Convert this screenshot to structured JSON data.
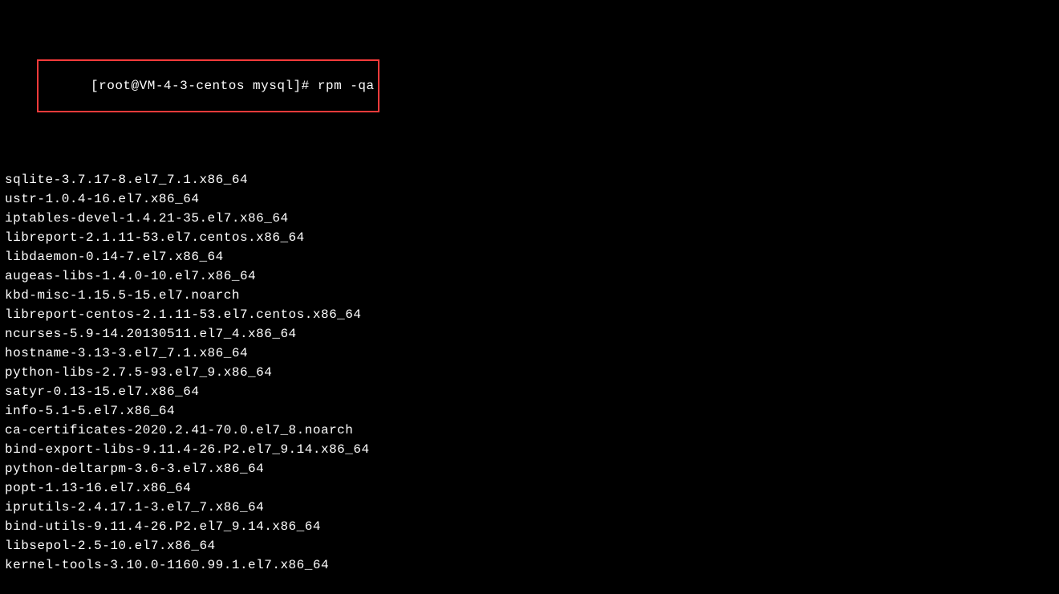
{
  "terminal": {
    "prompt": "[root@VM-4-3-centos mysql]# ",
    "command": "rpm -qa",
    "output": [
      "sqlite-3.7.17-8.el7_7.1.x86_64",
      "ustr-1.0.4-16.el7.x86_64",
      "iptables-devel-1.4.21-35.el7.x86_64",
      "libreport-2.1.11-53.el7.centos.x86_64",
      "libdaemon-0.14-7.el7.x86_64",
      "augeas-libs-1.4.0-10.el7.x86_64",
      "kbd-misc-1.15.5-15.el7.noarch",
      "libreport-centos-2.1.11-53.el7.centos.x86_64",
      "ncurses-5.9-14.20130511.el7_4.x86_64",
      "hostname-3.13-3.el7_7.1.x86_64",
      "python-libs-2.7.5-93.el7_9.x86_64",
      "satyr-0.13-15.el7.x86_64",
      "info-5.1-5.el7.x86_64",
      "ca-certificates-2020.2.41-70.0.el7_8.noarch",
      "bind-export-libs-9.11.4-26.P2.el7_9.14.x86_64",
      "python-deltarpm-3.6-3.el7.x86_64",
      "popt-1.13-16.el7.x86_64",
      "iprutils-2.4.17.1-3.el7_7.x86_64",
      "bind-utils-9.11.4-26.P2.el7_9.14.x86_64",
      "libsepol-2.5-10.el7.x86_64",
      "kernel-tools-3.10.0-1160.99.1.el7.x86_64"
    ]
  }
}
